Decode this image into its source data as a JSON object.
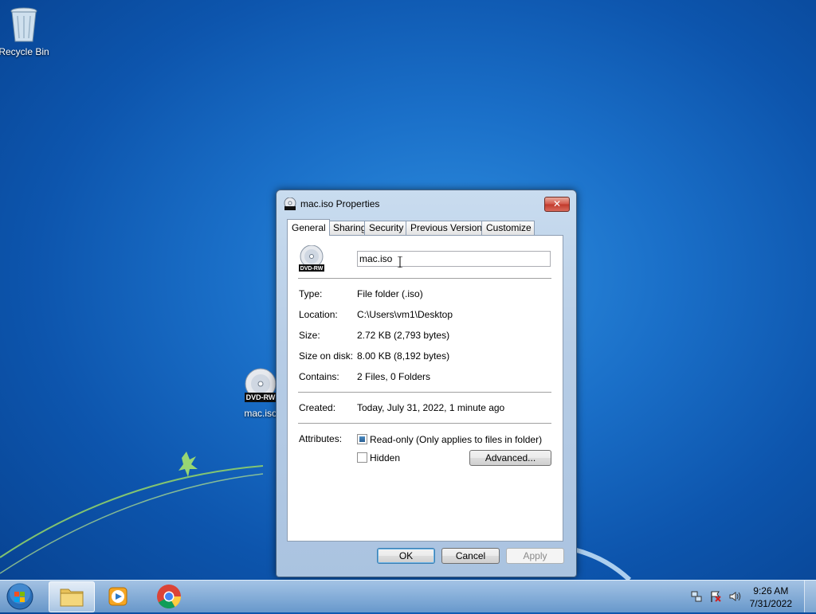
{
  "desktop": {
    "recycle_bin_label": "Recycle Bin",
    "iso_label": "mac.iso"
  },
  "dialog": {
    "title": "mac.iso Properties",
    "close_label": "✕",
    "tabs": [
      {
        "label": "General",
        "active": true
      },
      {
        "label": "Sharing",
        "active": false
      },
      {
        "label": "Security",
        "active": false
      },
      {
        "label": "Previous Versions",
        "active": false
      },
      {
        "label": "Customize",
        "active": false
      }
    ],
    "name_value": "mac.iso",
    "dvd_badge": "DVD-RW",
    "rows": [
      {
        "label": "Type:",
        "value": "File folder (.iso)"
      },
      {
        "label": "Location:",
        "value": "C:\\Users\\vm1\\Desktop"
      },
      {
        "label": "Size:",
        "value": "2.72 KB (2,793 bytes)"
      },
      {
        "label": "Size on disk:",
        "value": "8.00 KB (8,192 bytes)"
      },
      {
        "label": "Contains:",
        "value": "2 Files, 0 Folders"
      }
    ],
    "created": {
      "label": "Created:",
      "value": "Today, July 31, 2022, 1 minute ago"
    },
    "attributes": {
      "label": "Attributes:",
      "readonly_label": "Read-only (Only applies to files in folder)",
      "readonly_state": "indeterminate",
      "hidden_label": "Hidden",
      "hidden_state": "unchecked",
      "advanced_label": "Advanced..."
    },
    "buttons": {
      "ok": "OK",
      "cancel": "Cancel",
      "apply": "Apply"
    }
  },
  "taskbar": {
    "clock_time": "9:26 AM",
    "clock_date": "7/31/2022"
  }
}
